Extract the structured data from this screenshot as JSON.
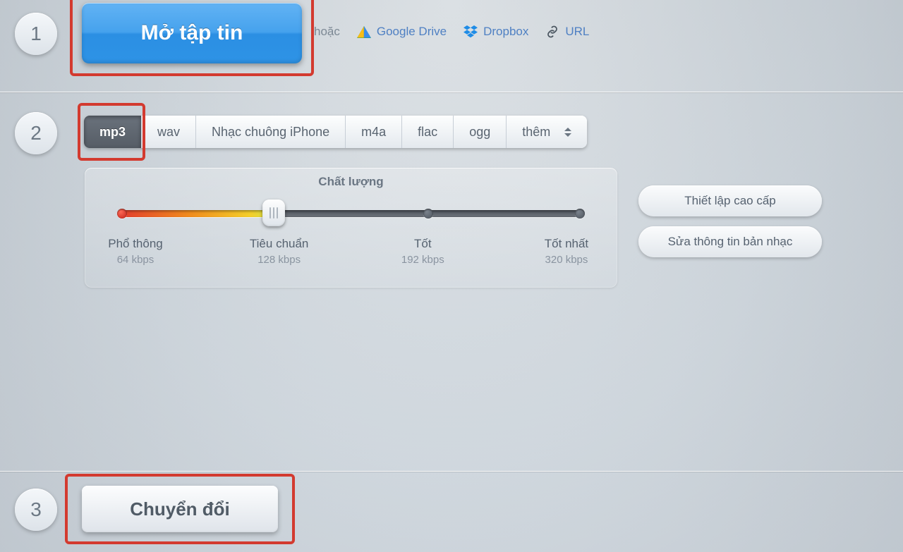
{
  "step1": {
    "number": "1",
    "open_label": "Mở tập tin",
    "or_label": "hoặc",
    "sources": {
      "drive": "Google Drive",
      "dropbox": "Dropbox",
      "url": "URL"
    }
  },
  "step2": {
    "number": "2",
    "formats": {
      "mp3": "mp3",
      "wav": "wav",
      "iphone": "Nhạc chuông iPhone",
      "m4a": "m4a",
      "flac": "flac",
      "ogg": "ogg",
      "more": "thêm"
    },
    "quality": {
      "title": "Chất lượng",
      "levels": [
        {
          "name": "Phổ thông",
          "bitrate": "64 kbps"
        },
        {
          "name": "Tiêu chuẩn",
          "bitrate": "128 kbps"
        },
        {
          "name": "Tốt",
          "bitrate": "192 kbps"
        },
        {
          "name": "Tốt nhất",
          "bitrate": "320 kbps"
        }
      ]
    },
    "advanced_label": "Thiết lập cao cấp",
    "edit_tags_label": "Sửa thông tin bản nhạc"
  },
  "step3": {
    "number": "3",
    "convert_label": "Chuyển đổi"
  }
}
